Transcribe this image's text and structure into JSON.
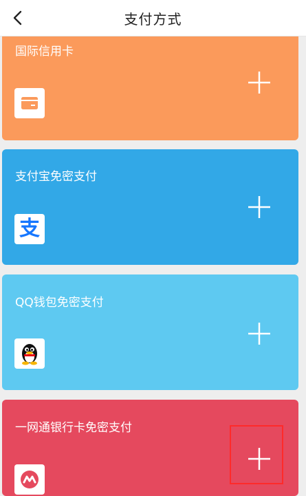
{
  "header": {
    "title": "支付方式",
    "back_icon": "chevron-left-icon"
  },
  "cards": [
    {
      "label": "国际信用卡",
      "color": "#fb9a5b",
      "icon": "card-icon",
      "add_icon": "plus-icon"
    },
    {
      "label": "支付宝免密支付",
      "color": "#32a8e7",
      "icon": "alipay-icon",
      "icon_glyph": "支",
      "icon_color": "#1677ff",
      "add_icon": "plus-icon"
    },
    {
      "label": "QQ钱包免密支付",
      "color": "#5ec9f1",
      "icon": "qq-penguin-icon",
      "add_icon": "plus-icon"
    },
    {
      "label": "一网通银行卡免密支付",
      "color": "#e5495e",
      "icon": "cmb-icon",
      "icon_color": "#e5495e",
      "add_icon": "plus-icon"
    }
  ]
}
